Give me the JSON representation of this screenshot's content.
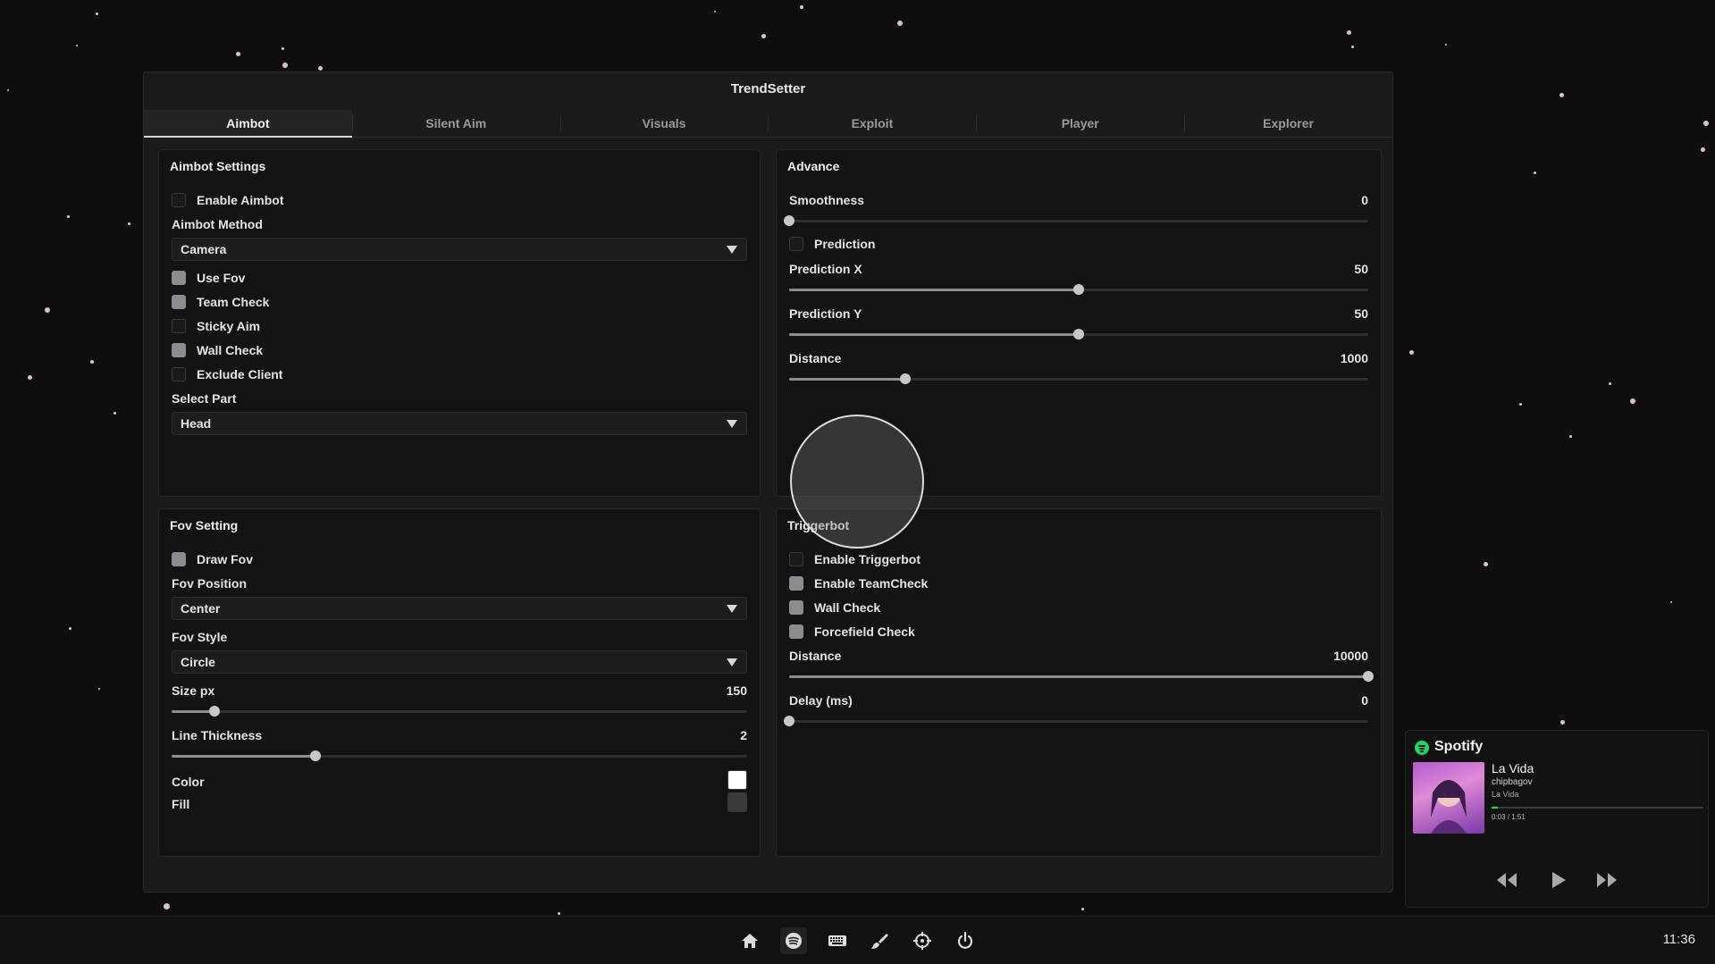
{
  "window": {
    "title": "TrendSetter",
    "tabs": [
      "Aimbot",
      "Silent Aim",
      "Visuals",
      "Exploit",
      "Player",
      "Explorer"
    ],
    "active_tab": "Aimbot"
  },
  "aimbot_settings": {
    "title": "Aimbot Settings",
    "enable_aimbot": {
      "label": "Enable Aimbot",
      "checked": false
    },
    "method": {
      "label": "Aimbot Method",
      "value": "Camera"
    },
    "use_fov": {
      "label": "Use Fov",
      "checked": true
    },
    "team_check": {
      "label": "Team Check",
      "checked": true
    },
    "sticky_aim": {
      "label": "Sticky Aim",
      "checked": false
    },
    "wall_check": {
      "label": "Wall Check",
      "checked": true
    },
    "exclude_client": {
      "label": "Exclude Client",
      "checked": false
    },
    "select_part": {
      "label": "Select Part",
      "value": "Head"
    }
  },
  "advance": {
    "title": "Advance",
    "smoothness": {
      "label": "Smoothness",
      "value": "0",
      "fraction": 0.0
    },
    "prediction": {
      "label": "Prediction",
      "checked": false
    },
    "prediction_x": {
      "label": "Prediction X",
      "value": "50",
      "fraction": 0.5
    },
    "prediction_y": {
      "label": "Prediction Y",
      "value": "50",
      "fraction": 0.5
    },
    "distance": {
      "label": "Distance",
      "value": "1000",
      "fraction": 0.2
    }
  },
  "fov_setting": {
    "title": "Fov Setting",
    "draw_fov": {
      "label": "Draw Fov",
      "checked": true
    },
    "position": {
      "label": "Fov Position",
      "value": "Center"
    },
    "style": {
      "label": "Fov Style",
      "value": "Circle"
    },
    "size": {
      "label": "Size px",
      "value": "150",
      "fraction": 0.075
    },
    "thickness": {
      "label": "Line Thickness",
      "value": "2",
      "fraction": 0.25
    },
    "color": {
      "label": "Color",
      "value": "#ffffff"
    },
    "fill": {
      "label": "Fill",
      "value": "#3a3a3c"
    }
  },
  "triggerbot": {
    "title": "Triggerbot",
    "enable": {
      "label": "Enable Triggerbot",
      "checked": false
    },
    "teamcheck": {
      "label": "Enable TeamCheck",
      "checked": true
    },
    "wall_check": {
      "label": "Wall Check",
      "checked": true
    },
    "forcefield": {
      "label": "Forcefield Check",
      "checked": true
    },
    "distance": {
      "label": "Distance",
      "value": "10000",
      "fraction": 1.0
    },
    "delay": {
      "label": "Delay (ms)",
      "value": "0",
      "fraction": 0.0
    }
  },
  "spotify": {
    "title": "Spotify",
    "song": "La Vida",
    "artist": "chipbagov",
    "album": "La Vida",
    "time": "0:03 / 1:51",
    "progress": 0.03,
    "icons": [
      "rewind-icon",
      "play-icon",
      "fast-forward-icon"
    ]
  },
  "taskbar": {
    "icons": [
      "home-icon",
      "spotify-icon",
      "keyboard-icon",
      "brush-icon",
      "crosshair-icon",
      "power-icon"
    ],
    "clock": "11:36"
  }
}
